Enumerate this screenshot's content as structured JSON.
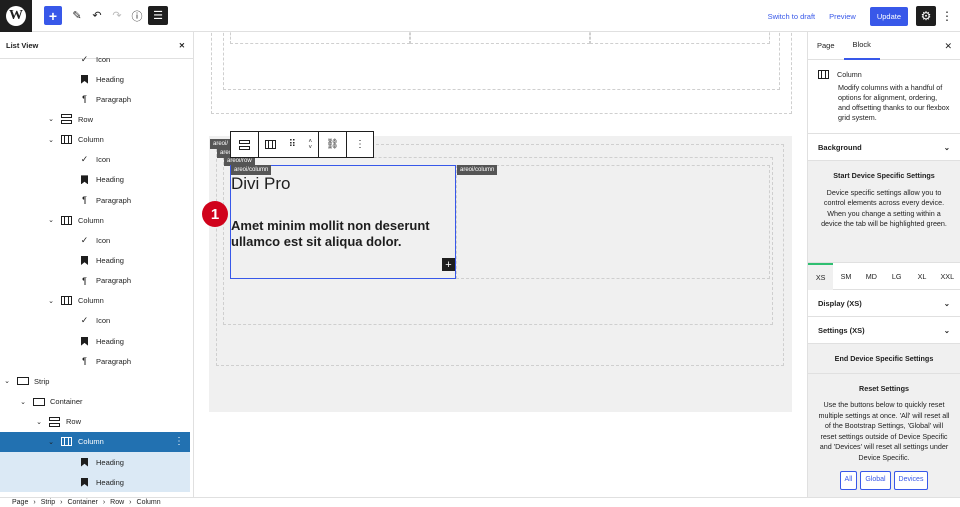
{
  "topbar": {
    "switch_draft": "Switch to draft",
    "preview": "Preview",
    "update": "Update"
  },
  "listview": {
    "title": "List View",
    "rows": [
      {
        "label": "Icon",
        "icon": "check-icon"
      },
      {
        "label": "Heading",
        "icon": "bookmark-icon"
      },
      {
        "label": "Paragraph",
        "icon": "pilcrow-icon"
      },
      {
        "label": "Row",
        "icon": "row-icon"
      },
      {
        "label": "Column",
        "icon": "column-icon"
      },
      {
        "label": "Icon",
        "icon": "check-icon"
      },
      {
        "label": "Heading",
        "icon": "bookmark-icon"
      },
      {
        "label": "Paragraph",
        "icon": "pilcrow-icon"
      },
      {
        "label": "Column",
        "icon": "column-icon"
      },
      {
        "label": "Icon",
        "icon": "check-icon"
      },
      {
        "label": "Heading",
        "icon": "bookmark-icon"
      },
      {
        "label": "Paragraph",
        "icon": "pilcrow-icon"
      },
      {
        "label": "Column",
        "icon": "column-icon"
      },
      {
        "label": "Icon",
        "icon": "check-icon"
      },
      {
        "label": "Heading",
        "icon": "bookmark-icon"
      },
      {
        "label": "Paragraph",
        "icon": "pilcrow-icon"
      },
      {
        "label": "Strip",
        "icon": "strip-icon"
      },
      {
        "label": "Container",
        "icon": "container-icon"
      },
      {
        "label": "Row",
        "icon": "row-icon"
      },
      {
        "label": "Column",
        "icon": "column-icon"
      },
      {
        "label": "Heading",
        "icon": "bookmark-icon"
      },
      {
        "label": "Heading",
        "icon": "bookmark-icon"
      }
    ]
  },
  "canvas": {
    "tag_row": "areoi/row",
    "tag_column": "areoi/column",
    "tag_column2": "areoi/column",
    "tag_areoi_1": "areoi/",
    "tag_areoi_2": "areo",
    "heading": "Divi Pro",
    "paragraph": "Amet minim mollit non deserunt ullamco est sit aliqua dolor.",
    "step_number": "1"
  },
  "sidebar": {
    "tab_page": "Page",
    "tab_block": "Block",
    "block_name": "Column",
    "block_desc": "Modify columns with a handful of options for alignment, ordering, and offsetting thanks to our flexbox grid system.",
    "background": "Background",
    "start_title": "Start Device Specific Settings",
    "start_desc": "Device specific settings allow you to control elements across every device. When you change a setting within a device the tab will be highlighted green.",
    "breakpoints": [
      "XS",
      "SM",
      "MD",
      "LG",
      "XL",
      "XXL"
    ],
    "display": "Display (XS)",
    "settings": "Settings (XS)",
    "end_title": "End Device Specific Settings",
    "reset_title": "Reset Settings",
    "reset_desc": "Use the buttons below to quickly reset multiple settings at once. 'All' will reset all of the Bootstrap Settings, 'Global' will reset settings outside of Device Specific and 'Devices' will reset all settings under Device Specific.",
    "btn_all": "All",
    "btn_global": "Global",
    "btn_devices": "Devices"
  },
  "breadcrumb": [
    "Page",
    "Strip",
    "Container",
    "Row",
    "Column"
  ],
  "colors": {
    "accent": "#3858e9",
    "selected": "#2271b1",
    "badge": "#d0021b",
    "active_bp": "#2fbf71"
  }
}
